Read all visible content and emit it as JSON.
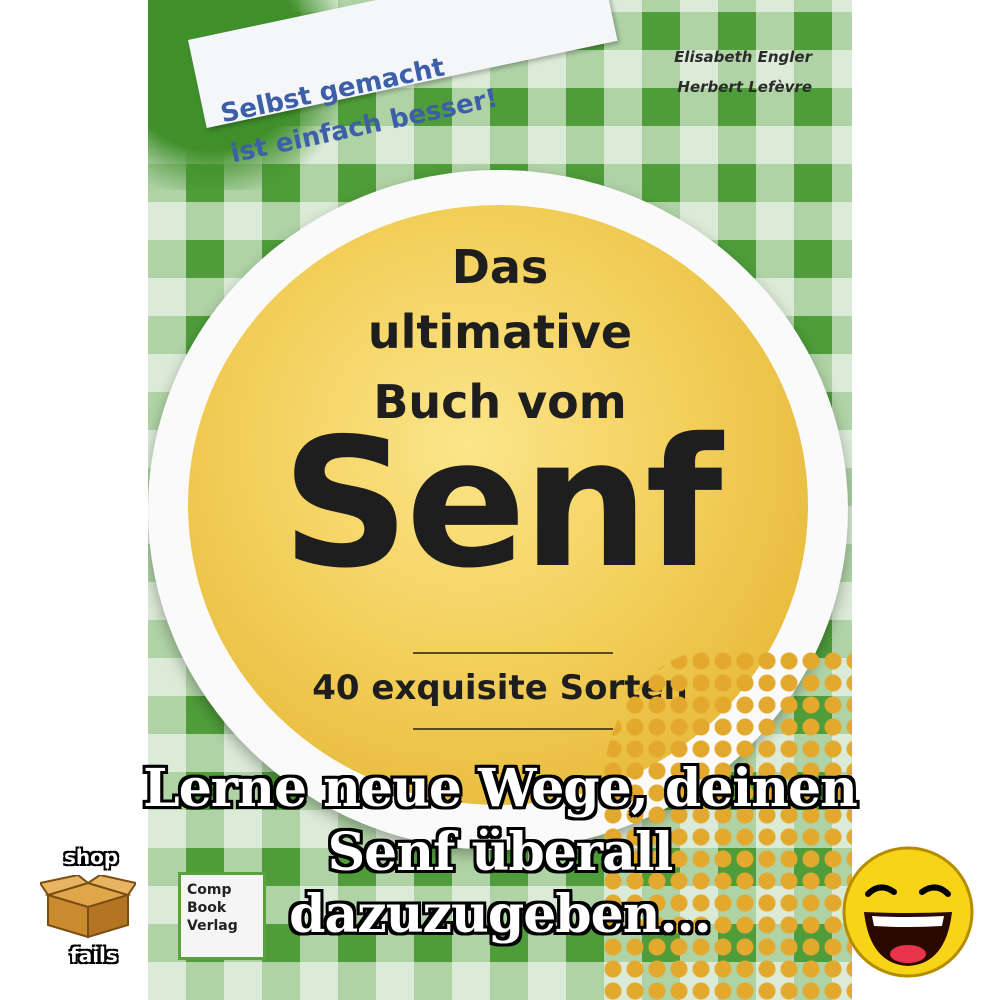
{
  "cover": {
    "sticker_line1": "Selbst gemacht",
    "sticker_line2": "ist einfach besser!",
    "author1": "Elisabeth Engler",
    "author2": "Herbert Lefèvre",
    "title_line1": "Das",
    "title_line2": "ultimative",
    "title_line3": "Buch vom",
    "title_main": "Senf",
    "subtitle": "40 exquisite Sorten",
    "publisher_lines": [
      "Comp",
      "Book",
      "Verlag"
    ],
    "accent_green": "#4f9d3a",
    "mustard_color": "#f3cf5a"
  },
  "caption": {
    "line1": "Lerne neue Wege, deinen",
    "line2": "Senf überall",
    "line3": "dazuzugeben..."
  },
  "badge": {
    "top": "shop",
    "bottom": "fails",
    "icon": "cardboard-box-icon"
  },
  "emoji": {
    "icon": "laughing-face-icon"
  }
}
